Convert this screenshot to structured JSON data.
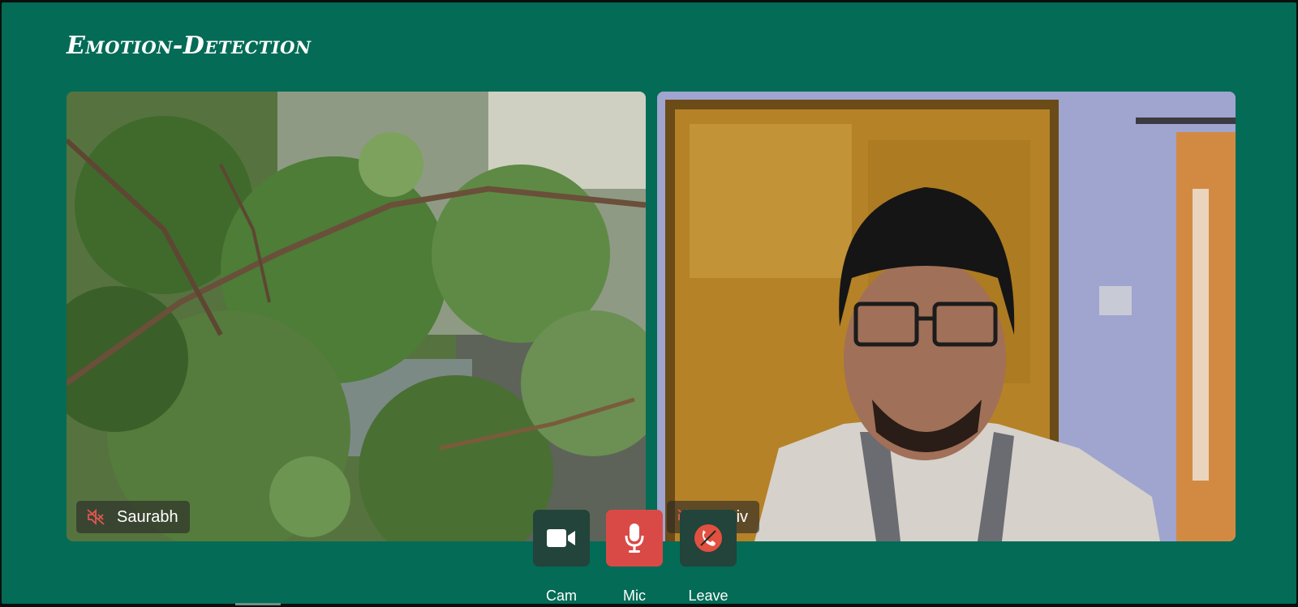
{
  "app": {
    "title": "Emotion-Detection"
  },
  "participants": [
    {
      "name": "Saurabh",
      "muted": true,
      "icon": "mic-muted-icon"
    },
    {
      "name": "Agniv",
      "muted": true,
      "icon": "mic-muted-icon"
    }
  ],
  "controls": {
    "cam": {
      "label": "Cam",
      "icon": "camera-icon"
    },
    "mic": {
      "label": "Mic",
      "icon": "microphone-icon",
      "state": "active"
    },
    "leave": {
      "label": "Leave",
      "icon": "phone-hangup-icon"
    }
  },
  "colors": {
    "background": "#036b56",
    "control_dark": "#22443a",
    "control_red": "#d94a47",
    "muted_icon": "#e0574f",
    "leave_icon": "#e25040"
  }
}
